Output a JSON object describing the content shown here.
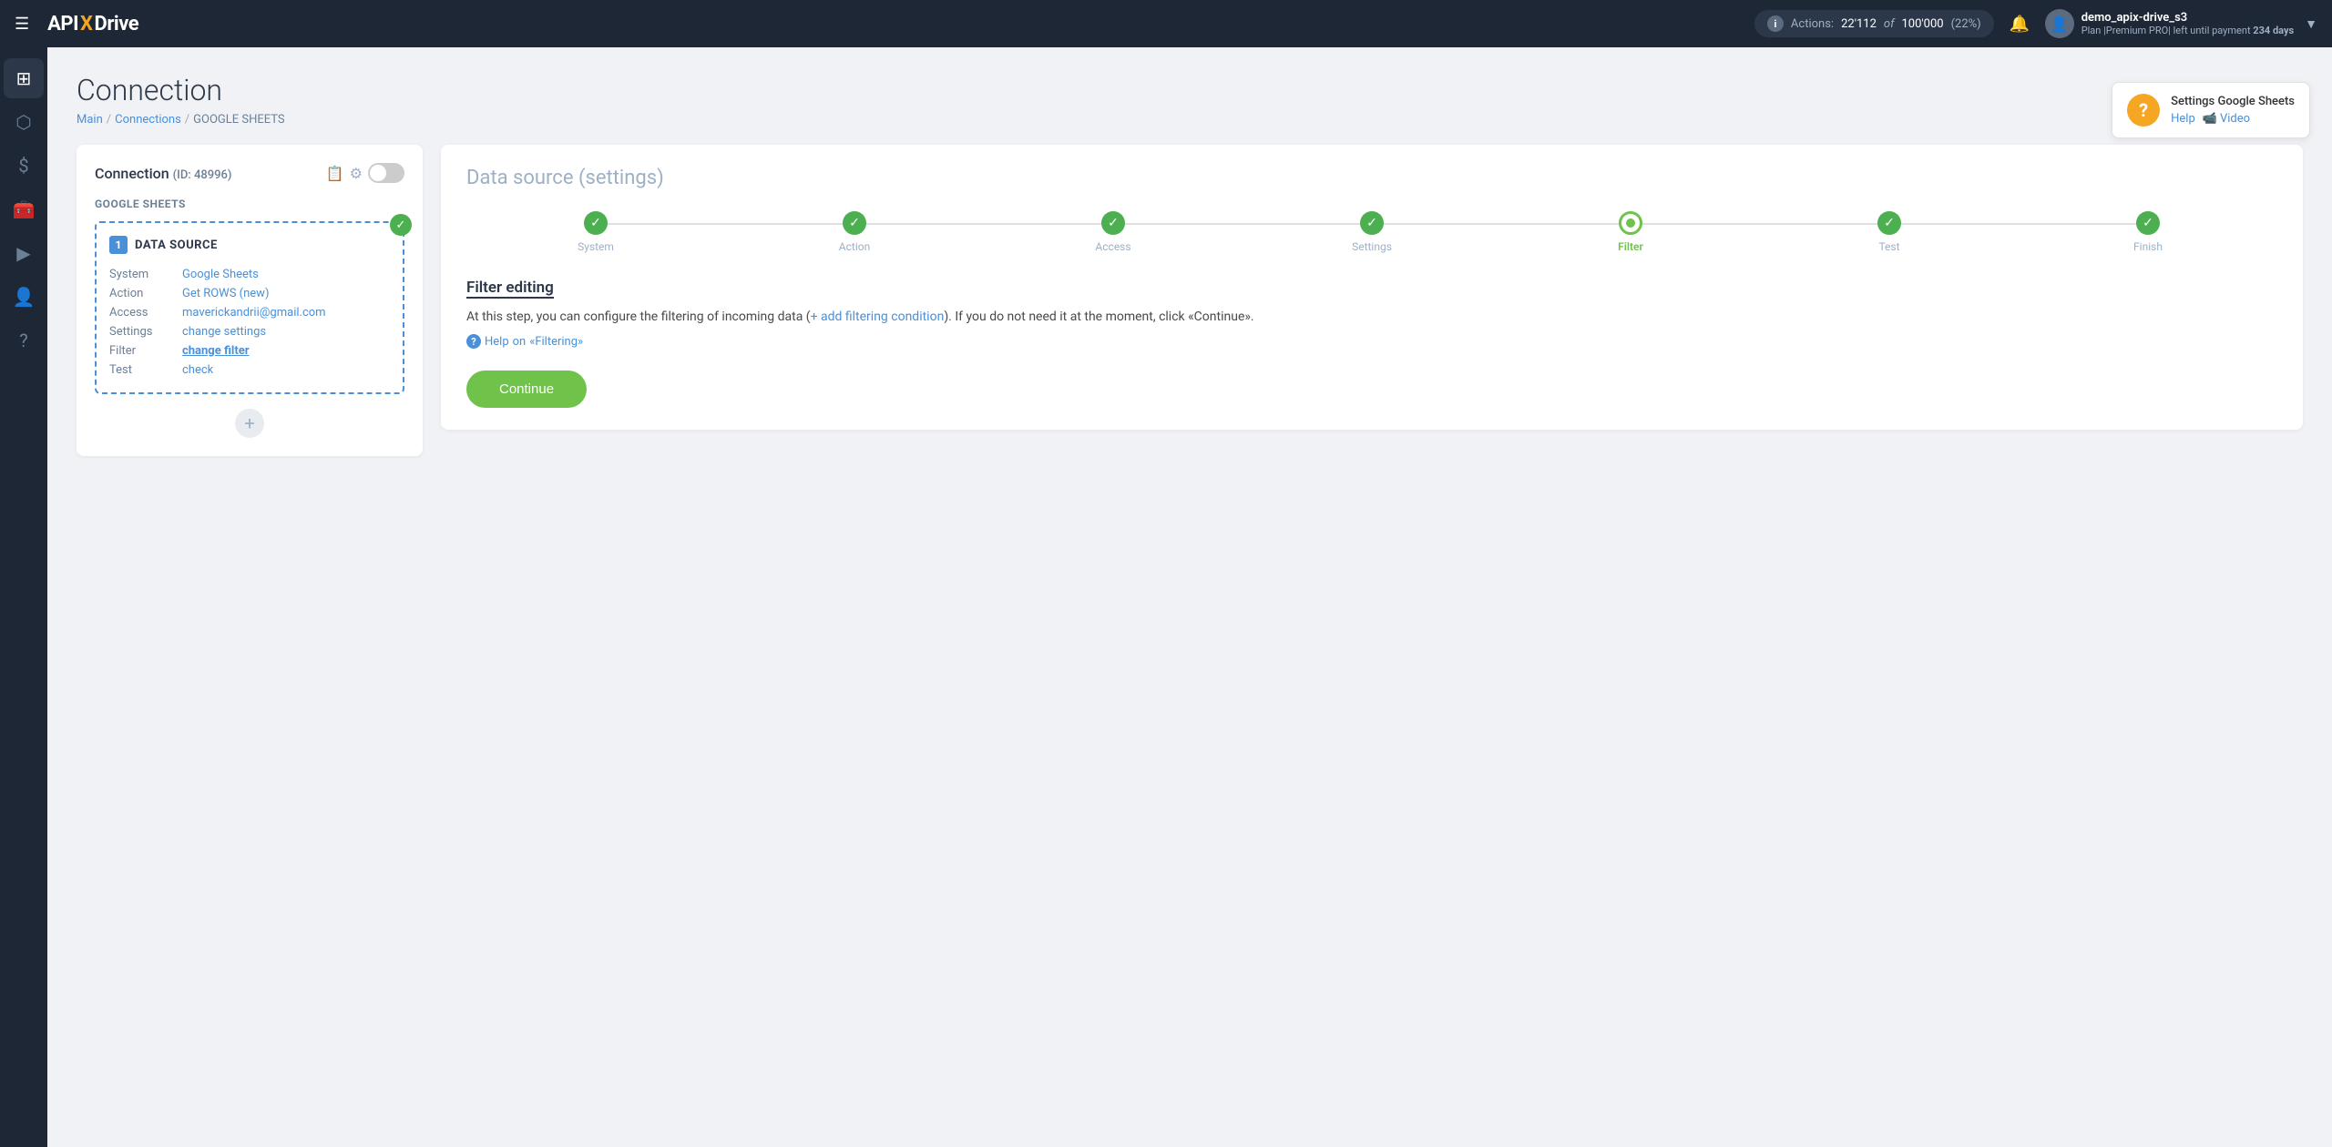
{
  "topnav": {
    "logo": "APiX-Drive",
    "actions_label": "Actions:",
    "actions_count": "22'112",
    "actions_of": "of",
    "actions_total": "100'000",
    "actions_pct": "(22%)",
    "user_name": "demo_apix-drive_s3",
    "user_plan": "Plan |Premium PRO| left until payment",
    "user_days": "234 days"
  },
  "sidebar": {
    "items": [
      {
        "icon": "⊞",
        "name": "dashboard"
      },
      {
        "icon": "⬡",
        "name": "connections"
      },
      {
        "icon": "$",
        "name": "billing"
      },
      {
        "icon": "🧰",
        "name": "tools"
      },
      {
        "icon": "▶",
        "name": "media"
      },
      {
        "icon": "👤",
        "name": "profile"
      },
      {
        "icon": "?",
        "name": "help"
      }
    ]
  },
  "page": {
    "title": "Connection",
    "breadcrumb": {
      "main": "Main",
      "connections": "Connections",
      "current": "GOOGLE SHEETS"
    }
  },
  "help_tooltip": {
    "title": "Settings Google Sheets",
    "help_label": "Help",
    "video_label": "Video"
  },
  "left_panel": {
    "title": "Connection",
    "id_label": "(ID: 48996)",
    "subtitle": "GOOGLE SHEETS",
    "datasource": {
      "number": "1",
      "label": "DATA SOURCE",
      "rows": [
        {
          "key": "System",
          "value": "Google Sheets",
          "is_link": true,
          "is_bold": false
        },
        {
          "key": "Action",
          "value": "Get ROWS (new)",
          "is_link": true,
          "is_bold": false
        },
        {
          "key": "Access",
          "value": "maverickandrii@gmail.com",
          "is_link": true,
          "is_bold": false
        },
        {
          "key": "Settings",
          "value": "change settings",
          "is_link": true,
          "is_bold": false
        },
        {
          "key": "Filter",
          "value": "change filter",
          "is_link": true,
          "is_bold": true
        },
        {
          "key": "Test",
          "value": "check",
          "is_link": true,
          "is_bold": false
        }
      ]
    }
  },
  "right_panel": {
    "title": "Data source",
    "title_sub": "(settings)",
    "steps": [
      {
        "label": "System",
        "done": true,
        "active": false
      },
      {
        "label": "Action",
        "done": true,
        "active": false
      },
      {
        "label": "Access",
        "done": true,
        "active": false
      },
      {
        "label": "Settings",
        "done": true,
        "active": false
      },
      {
        "label": "Filter",
        "done": false,
        "active": true
      },
      {
        "label": "Test",
        "done": true,
        "active": false
      },
      {
        "label": "Finish",
        "done": true,
        "active": false
      }
    ],
    "filter_title": "Filter editing",
    "filter_desc_pre": "At this step, you can configure the filtering of incoming data (",
    "filter_add_link": "+ add filtering condition",
    "filter_desc_post": "). If you do not need it at the moment, click «Continue».",
    "filter_help_text": "Help",
    "filter_help_on": "on",
    "filter_help_topic": "«Filtering»",
    "continue_label": "Continue"
  }
}
